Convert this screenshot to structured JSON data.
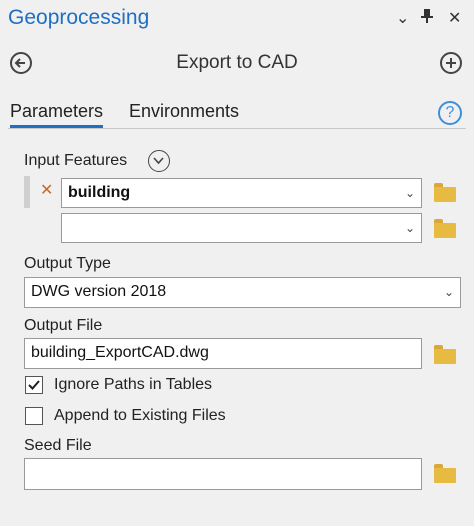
{
  "panel": {
    "title": "Geoprocessing",
    "controls": {
      "options": "⌄",
      "pin": "⊥",
      "close": "✕"
    }
  },
  "tool": {
    "title": "Export to CAD",
    "back_icon": "back-arrow-icon",
    "add_icon": "plus-icon"
  },
  "tabs": [
    {
      "label": "Parameters",
      "active": true
    },
    {
      "label": "Environments",
      "active": false
    }
  ],
  "help": {
    "glyph": "?"
  },
  "form": {
    "input_features": {
      "label": "Input Features",
      "items": [
        {
          "value": "building"
        },
        {
          "value": ""
        }
      ]
    },
    "output_type": {
      "label": "Output Type",
      "value": "DWG version 2018"
    },
    "output_file": {
      "label": "Output File",
      "value": "building_ExportCAD.dwg"
    },
    "ignore_paths": {
      "label": "Ignore Paths in Tables",
      "checked": true
    },
    "append_existing": {
      "label": "Append to Existing Files",
      "checked": false
    },
    "seed_file": {
      "label": "Seed File",
      "value": ""
    }
  },
  "colors": {
    "accent": "#1f6fc5",
    "folder": "#e7bb42",
    "remove": "#c86a2a"
  }
}
